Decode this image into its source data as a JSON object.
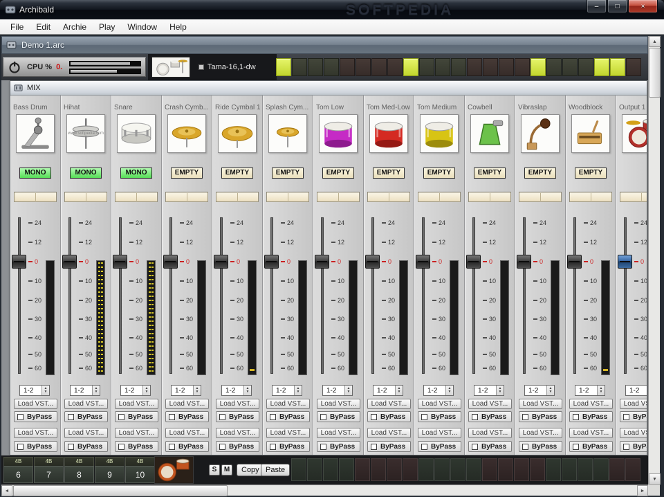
{
  "window": {
    "title": "Archibald",
    "watermark": "SOFTPEDIA",
    "controls": {
      "minimize": "–",
      "maximize": "□",
      "close": "×"
    }
  },
  "menu": {
    "items": [
      "File",
      "Edit",
      "Archie",
      "Play",
      "Window",
      "Help"
    ]
  },
  "doc_window": {
    "title": "Demo 1.arc"
  },
  "toolbar": {
    "cpu_label": "CPU %",
    "cpu_value": "0.",
    "kit_name": "Tama-16,1-dw"
  },
  "top_sequencer": {
    "cells": [
      "on",
      "green",
      "green",
      "green",
      "red",
      "red",
      "red",
      "red",
      "on",
      "green",
      "green",
      "green",
      "red",
      "red",
      "red",
      "red",
      "on",
      "green",
      "green",
      "green",
      "on",
      "on",
      "red"
    ]
  },
  "mix_window": {
    "title": "MIX"
  },
  "strings": {
    "load_vst": "Load VST...",
    "bypass": "ByPass",
    "mono": "MONO",
    "empty": "EMPTY",
    "spinner_up": "▲",
    "spinner_down": "▼"
  },
  "fader": {
    "scale": [
      "24",
      "12",
      "0",
      "10",
      "20",
      "30",
      "40",
      "50",
      "60"
    ]
  },
  "channels": [
    {
      "name": "Bass Drum",
      "slot": "MONO",
      "output": "1-2",
      "icon": "bass-pedal",
      "meter": "plain",
      "fader": "dark"
    },
    {
      "name": "Hihat",
      "slot": "MONO",
      "output": "1-2",
      "icon": "hihat",
      "meter": "dashed",
      "fader": "dark",
      "watermark": "www.softpedia.com"
    },
    {
      "name": "Snare",
      "slot": "MONO",
      "output": "1-2",
      "icon": "snare",
      "meter": "dashed",
      "fader": "dark"
    },
    {
      "name": "Crash Cymb...",
      "slot": "EMPTY",
      "output": "1-2",
      "icon": "cymbal",
      "meter": "plain",
      "fader": "dark"
    },
    {
      "name": "Ride Cymbal 1",
      "slot": "EMPTY",
      "output": "1-2",
      "icon": "cymbal-big",
      "meter": "mark",
      "fader": "dark"
    },
    {
      "name": "Splash Cym...",
      "slot": "EMPTY",
      "output": "1-2",
      "icon": "cymbal-small",
      "meter": "plain",
      "fader": "dark"
    },
    {
      "name": "Tom Low",
      "slot": "EMPTY",
      "output": "1-2",
      "icon": "tom-magenta",
      "meter": "plain",
      "fader": "dark"
    },
    {
      "name": "Tom Med-Low",
      "slot": "EMPTY",
      "output": "1-2",
      "icon": "tom-red",
      "meter": "plain",
      "fader": "dark"
    },
    {
      "name": "Tom Medium",
      "slot": "EMPTY",
      "output": "1-2",
      "icon": "tom-yellow",
      "meter": "plain",
      "fader": "dark"
    },
    {
      "name": "Cowbell",
      "slot": "EMPTY",
      "output": "1-2",
      "icon": "cowbell",
      "meter": "plain",
      "fader": "dark"
    },
    {
      "name": "Vibraslap",
      "slot": "EMPTY",
      "output": "1-2",
      "icon": "vibraslap",
      "meter": "plain",
      "fader": "dark"
    },
    {
      "name": "Woodblock",
      "slot": "EMPTY",
      "output": "1-2",
      "icon": "woodblock",
      "meter": "mark",
      "fader": "dark"
    },
    {
      "name": "Output 1",
      "slot": "",
      "output": "1-2",
      "icon": "drumkit",
      "meter": "mark",
      "fader": "blue"
    }
  ],
  "bottom_bar": {
    "pattern_slots": [
      {
        "bars": "4B",
        "num": "6"
      },
      {
        "bars": "4B",
        "num": "7"
      },
      {
        "bars": "4B",
        "num": "8"
      },
      {
        "bars": "4B",
        "num": "9"
      },
      {
        "bars": "4B",
        "num": "10"
      }
    ],
    "solo": "S",
    "mute": "M",
    "copy": "Copy",
    "paste": "Paste",
    "cells": [
      "green",
      "green",
      "green",
      "green",
      "red",
      "red",
      "red",
      "red",
      "green",
      "green",
      "green",
      "green",
      "red",
      "red",
      "red",
      "red",
      "green",
      "green",
      "green",
      "green",
      "red",
      "red"
    ]
  },
  "scrollbars": {
    "up": "▲",
    "down": "▼",
    "left": "◄",
    "right": "►"
  }
}
